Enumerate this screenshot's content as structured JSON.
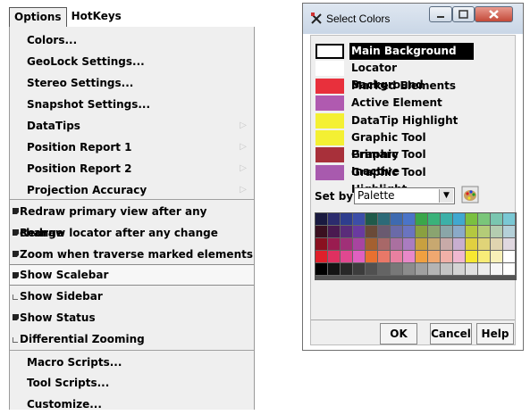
{
  "menubar": {
    "items": [
      "Options",
      "HotKeys"
    ]
  },
  "menu": {
    "items": [
      {
        "label": "Colors...",
        "submenu": false,
        "check": null
      },
      {
        "label": "GeoLock Settings...",
        "submenu": false,
        "check": null
      },
      {
        "label": "Stereo Settings...",
        "submenu": false,
        "check": null
      },
      {
        "label": "Snapshot Settings...",
        "submenu": false,
        "check": null
      },
      {
        "label": "DataTips",
        "submenu": true,
        "check": null
      },
      {
        "label": "Position Report 1",
        "submenu": true,
        "check": null
      },
      {
        "label": "Position Report 2",
        "submenu": true,
        "check": null
      },
      {
        "label": "Projection Accuracy",
        "submenu": true,
        "check": null
      },
      {
        "label": "Redraw primary view after any change",
        "submenu": false,
        "check": true
      },
      {
        "label": "Redraw locator after any change",
        "submenu": false,
        "check": true
      },
      {
        "label": "Zoom when traverse marked elements",
        "submenu": false,
        "check": true
      },
      {
        "label": "Show Scalebar",
        "submenu": false,
        "check": true,
        "highlighted": true
      },
      {
        "label": "Show Sidebar",
        "submenu": false,
        "check": false
      },
      {
        "label": "Show Status",
        "submenu": false,
        "check": true
      },
      {
        "label": "Differential Zooming",
        "submenu": false,
        "check": false
      },
      {
        "label": "Macro Scripts...",
        "submenu": false,
        "check": null
      },
      {
        "label": "Tool Scripts...",
        "submenu": false,
        "check": null
      },
      {
        "label": "Customize...",
        "submenu": false,
        "check": null
      }
    ]
  },
  "dialog": {
    "title": "Select Colors",
    "color_items": [
      {
        "label": "Main Background",
        "color": "#ffffff",
        "selected": true
      },
      {
        "label": "Locator Background",
        "color": "#ffffff"
      },
      {
        "label": "Marked Elements",
        "color": "#e8303c"
      },
      {
        "label": "Active Element",
        "color": "#b05ab0"
      },
      {
        "label": "DataTip Highlight",
        "color": "#f4f033"
      },
      {
        "label": "Graphic Tool Primary",
        "color": "#f4f033"
      },
      {
        "label": "Graphic Tool Inactive",
        "color": "#a8303a"
      },
      {
        "label": "Graphic Tool Highlight",
        "color": "#a85aae"
      }
    ],
    "set_by_label": "Set by",
    "set_by_value": "Palette",
    "palette": [
      [
        "#1a1a40",
        "#2c2c6e",
        "#2e3e8e",
        "#3c4ea8",
        "#1f5a4a",
        "#2c6a78",
        "#3e6ab0",
        "#4a74c8",
        "#3aa64a",
        "#3ab27a",
        "#3cb0a8",
        "#40a8d0",
        "#7ac040",
        "#7ac67a",
        "#7ac6b0",
        "#7ac8d4"
      ],
      [
        "#3a1020",
        "#4a1a50",
        "#5a2c7a",
        "#6a3aa0",
        "#6a4a38",
        "#6a5a70",
        "#6a6aa8",
        "#6a74c0",
        "#8aa040",
        "#8aa470",
        "#8aa6a8",
        "#8aaac8",
        "#b4c840",
        "#b4cc78",
        "#b4ccb0",
        "#b4d0d8"
      ],
      [
        "#8a1020",
        "#9a1c50",
        "#a03078",
        "#a844a0",
        "#a46030",
        "#a86868",
        "#aa70a0",
        "#aa7cc0",
        "#c8a040",
        "#c8a870",
        "#c8aaa8",
        "#c8aed0",
        "#e0d040",
        "#e0d478",
        "#e0d4b0",
        "#e0d8e0"
      ],
      [
        "#e0202a",
        "#e03060",
        "#e04890",
        "#e060c0",
        "#e87030",
        "#e87868",
        "#e880a0",
        "#e888c8",
        "#f0a040",
        "#f0a870",
        "#f0b0a8",
        "#f0b8d0",
        "#f8e830",
        "#f8ec78",
        "#f8f0b8",
        "#ffffff"
      ],
      [
        "#000000",
        "#141414",
        "#282828",
        "#3c3c3c",
        "#505050",
        "#646464",
        "#787878",
        "#8c8c8c",
        "#a0a0a0",
        "#b4b4b4",
        "#c4c4c4",
        "#d4d4d4",
        "#e0e0e0",
        "#ececec",
        "#f6f6f6",
        "#ffffff"
      ]
    ],
    "buttons": {
      "ok": "OK",
      "cancel": "Cancel",
      "help": "Help"
    },
    "icons": [
      "app-icon",
      "minimize-icon",
      "maximize-icon",
      "close-icon",
      "palette-icon"
    ]
  }
}
